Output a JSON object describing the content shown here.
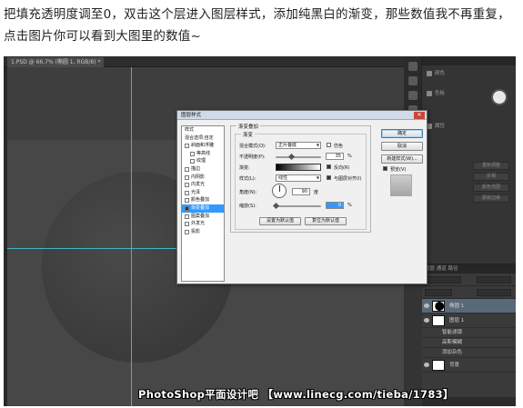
{
  "intro_text": "把填充透明度调至0，双击这个层进入图层样式，添加纯黑白的渐变，那些数值我不再重复，点击图片你可以看到大图里的数值~",
  "document_tab": "1.PSD @ 66.7% (椭圆 1, RGB/8) *",
  "right_panel": {
    "rows": [
      "颜色",
      "色板",
      "属性"
    ],
    "prop_buttons": [
      "重新调整",
      "反相",
      "颜色范围",
      "蒙版边缘"
    ]
  },
  "dialog": {
    "title": "图层样式",
    "close_glyph": "✕",
    "styles_header": "样式",
    "blend_options": "混合选项:自定",
    "style_items": [
      {
        "label": "斜面和浮雕",
        "checked": false,
        "nested": false
      },
      {
        "label": "等高线",
        "checked": false,
        "nested": true
      },
      {
        "label": "纹理",
        "checked": false,
        "nested": true
      },
      {
        "label": "描边",
        "checked": false,
        "nested": false
      },
      {
        "label": "内阴影",
        "checked": false,
        "nested": false
      },
      {
        "label": "内发光",
        "checked": false,
        "nested": false
      },
      {
        "label": "光泽",
        "checked": false,
        "nested": false
      },
      {
        "label": "颜色叠加",
        "checked": false,
        "nested": false
      },
      {
        "label": "渐变叠加",
        "checked": true,
        "nested": false,
        "selected": true
      },
      {
        "label": "图案叠加",
        "checked": false,
        "nested": false
      },
      {
        "label": "外发光",
        "checked": false,
        "nested": false
      },
      {
        "label": "投影",
        "checked": false,
        "nested": false
      }
    ],
    "group_title": "渐变叠加",
    "subgroup_title": "渐变",
    "blend_mode_label": "混合模式(O):",
    "blend_mode_value": "正片叠底",
    "dither_label": "仿色",
    "opacity_label": "不透明度(P):",
    "opacity_value": "35",
    "opacity_fraction": 0.35,
    "percent": "%",
    "gradient_label": "渐变:",
    "reverse_label": "反向(R)",
    "style_label": "样式(L):",
    "style_value": "线性",
    "align_label": "与图层对齐(I)",
    "angle_label": "角度(N):",
    "angle_value": "90",
    "degree_unit": "度",
    "scale_label": "缩放(S):",
    "scale_value": "0",
    "scale_fraction": 0,
    "make_default": "设置为默认值",
    "reset_default": "复位为默认值",
    "ok": "确定",
    "cancel": "取消",
    "new_style": "新建样式(W)...",
    "preview_label": "预览(V)"
  },
  "layers_panel": {
    "tabs": "图层  通道  路径",
    "layers": [
      {
        "name": "椭圆 1",
        "selected": true,
        "thumb": "dark"
      },
      {
        "name": "图层 1",
        "selected": false,
        "thumb": "light"
      }
    ],
    "sub_items": [
      "智能滤镜",
      "高斯模糊",
      "添加杂色"
    ],
    "background": "背景"
  },
  "watermark": "PhotoShop平面设计吧  【www.linecg.com/tieba/1783】"
}
